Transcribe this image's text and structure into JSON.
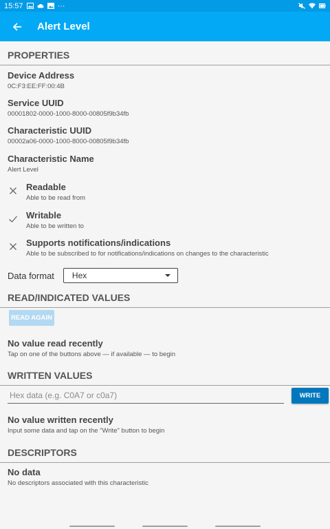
{
  "status_bar": {
    "time": "15:57",
    "ellipsis": "···"
  },
  "app_bar": {
    "title": "Alert Level"
  },
  "properties": {
    "header": "PROPERTIES",
    "device_address": {
      "title": "Device Address",
      "value": "0C:F3:EE:FF:00:4B"
    },
    "service_uuid": {
      "title": "Service UUID",
      "value": "00001802-0000-1000-8000-00805f9b34fb"
    },
    "characteristic_uuid": {
      "title": "Characteristic UUID",
      "value": "00002a06-0000-1000-8000-00805f9b34fb"
    },
    "characteristic_name": {
      "title": "Characteristic Name",
      "value": "Alert Level"
    },
    "capabilities": [
      {
        "title": "Readable",
        "desc": "Able to be read from",
        "supported": false,
        "icon": "cross-icon"
      },
      {
        "title": "Writable",
        "desc": "Able to be written to",
        "supported": true,
        "icon": "check-icon"
      },
      {
        "title": "Supports notifications/indications",
        "desc": "Able to be subscribed to for notifications/indications on changes to the characteristic",
        "supported": false,
        "icon": "cross-icon"
      }
    ],
    "data_format": {
      "label": "Data format",
      "selected": "Hex"
    }
  },
  "read_values": {
    "header": "READ/INDICATED VALUES",
    "read_again_label": "READ AGAIN",
    "empty_title": "No value read recently",
    "empty_desc": "Tap on one of the buttons above — if available — to begin"
  },
  "written_values": {
    "header": "WRITTEN VALUES",
    "input_placeholder": "Hex data (e.g. C0A7 or c0a7)",
    "input_value": "",
    "write_label": "WRITE",
    "empty_title": "No value written recently",
    "empty_desc": "Input some data and tap on the \"Write\" button to begin"
  },
  "descriptors": {
    "header": "DESCRIPTORS",
    "empty_title": "No data",
    "empty_desc": "No descriptors associated with this characteristic"
  },
  "colors": {
    "status_bar": "#039be5",
    "app_bar": "#03a9f4",
    "write_button": "#0277bd",
    "disabled_button": "#b3d9f2"
  }
}
